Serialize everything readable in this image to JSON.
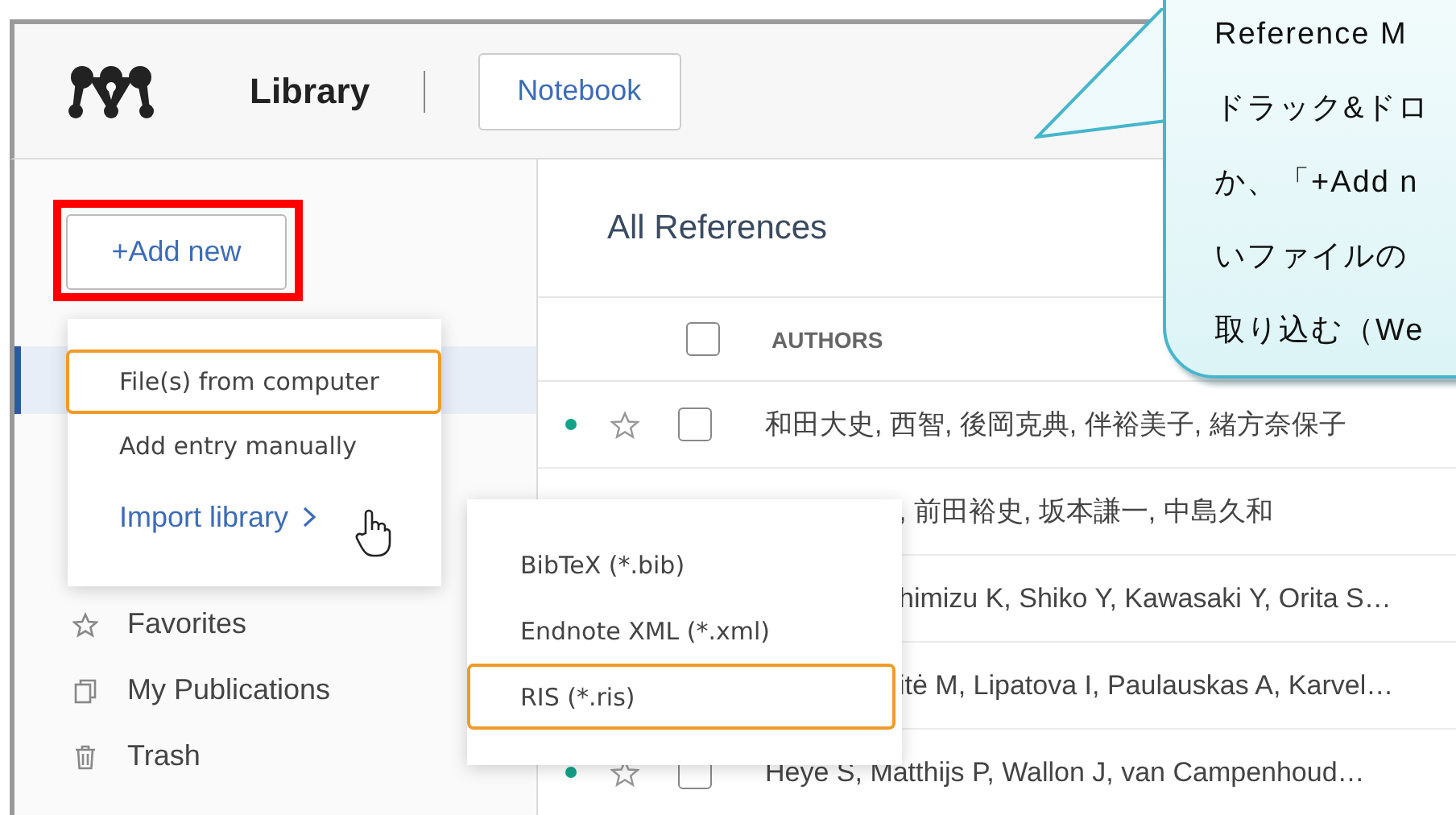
{
  "header": {
    "title": "Library",
    "notebook_button": "Notebook"
  },
  "sidebar": {
    "add_button": "+Add new",
    "items": [
      {
        "label": "Favorites",
        "kind": "star"
      },
      {
        "label": "My Publications",
        "kind": "publications"
      },
      {
        "label": "Trash",
        "kind": "trash"
      }
    ]
  },
  "add_menu": {
    "items": [
      {
        "label": "File(s) from computer",
        "selected": true,
        "kind": "plain"
      },
      {
        "label": "Add entry manually",
        "selected": false,
        "kind": "plain"
      },
      {
        "label": "Import library",
        "selected": false,
        "kind": "submenu"
      }
    ]
  },
  "import_submenu": {
    "items": [
      {
        "label": "BibTeX (*.bib)",
        "selected": false
      },
      {
        "label": "Endnote XML (*.xml)",
        "selected": false
      },
      {
        "label": "RIS (*.ris)",
        "selected": true
      }
    ]
  },
  "content": {
    "title": "All References",
    "all_checked": false,
    "columns": [
      "AUTHORS"
    ],
    "rows": [
      {
        "kind": "full",
        "authors": "和田大史, 西智, 後岡克典, 伴裕美子, 緒方奈保子",
        "unread": true,
        "starred": false,
        "checked": false
      },
      {
        "kind": "partial",
        "authors": ", 前田裕史, 坂本謙一, 中島久和"
      },
      {
        "kind": "partial",
        "authors": "himizu K, Shiko Y, Kawasaki Y, Orita S…"
      },
      {
        "kind": "partial",
        "authors": "itė M, Lipatova I, Paulauskas A, Karvel…"
      },
      {
        "kind": "full",
        "authors": "Heye S, Matthijs P, Wallon J, van Campenhoud…",
        "unread": true,
        "starred": false,
        "checked": false
      }
    ]
  },
  "callout": {
    "lines": [
      "Reference M",
      "ドラック&ドロ",
      "か、「+Add n",
      "いファイルの",
      "取り込む（We"
    ]
  }
}
